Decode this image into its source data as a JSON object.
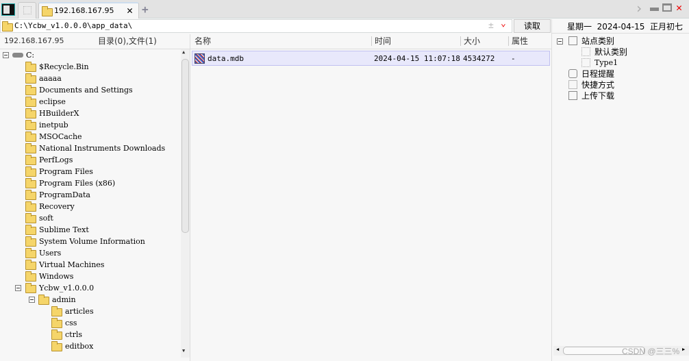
{
  "tabs": {
    "active": "192.168.167.95",
    "close": "✕",
    "add": "+"
  },
  "window": {
    "next": "›",
    "min": "▬",
    "max": "□",
    "close": "✕"
  },
  "address": {
    "path": "C:\\Ycbw_v1.0.0.0\\app_data\\",
    "plusminus": "±",
    "dropdown": "⌄",
    "read_button": "读取"
  },
  "left_panel": {
    "host": "192.168.167.95",
    "summary": "目录(0),文件(1)",
    "tree": [
      {
        "label": "C:",
        "level": 0,
        "expanded": true,
        "drive": true
      },
      {
        "label": "$Recycle.Bin",
        "level": 1
      },
      {
        "label": "aaaaa",
        "level": 1
      },
      {
        "label": "Documents and Settings",
        "level": 1
      },
      {
        "label": "eclipse",
        "level": 1
      },
      {
        "label": "HBuilderX",
        "level": 1
      },
      {
        "label": "inetpub",
        "level": 1
      },
      {
        "label": "MSOCache",
        "level": 1
      },
      {
        "label": "National Instruments Downloads",
        "level": 1
      },
      {
        "label": "PerfLogs",
        "level": 1
      },
      {
        "label": "Program Files",
        "level": 1
      },
      {
        "label": "Program Files (x86)",
        "level": 1
      },
      {
        "label": "ProgramData",
        "level": 1
      },
      {
        "label": "Recovery",
        "level": 1
      },
      {
        "label": "soft",
        "level": 1
      },
      {
        "label": "Sublime Text",
        "level": 1
      },
      {
        "label": "System Volume Information",
        "level": 1
      },
      {
        "label": "Users",
        "level": 1
      },
      {
        "label": "Virtual Machines",
        "level": 1
      },
      {
        "label": "Windows",
        "level": 1
      },
      {
        "label": "Ycbw_v1.0.0.0",
        "level": 1,
        "expanded": true
      },
      {
        "label": "admin",
        "level": 2,
        "expanded": true
      },
      {
        "label": "articles",
        "level": 3
      },
      {
        "label": "css",
        "level": 3
      },
      {
        "label": "ctrls",
        "level": 3
      },
      {
        "label": "editbox",
        "level": 3
      }
    ]
  },
  "file_list": {
    "columns": [
      "名称",
      "时间",
      "大小",
      "属性"
    ],
    "rows": [
      {
        "name": "data.mdb",
        "time": "2024-04-15 11:07:18",
        "size": "4534272",
        "attr": "-"
      }
    ]
  },
  "right_panel": {
    "date": "星期一  2024-04-15  正月初七",
    "tree": [
      {
        "label": "站点类别",
        "level": 0
      },
      {
        "label": "默认类别",
        "level": 1
      },
      {
        "label": "Type1",
        "level": 1
      },
      {
        "label": "日程提醒",
        "level": 0
      },
      {
        "label": "快捷方式",
        "level": 0
      },
      {
        "label": "上传下载",
        "level": 0
      }
    ]
  },
  "watermark": "CSDN @三三%"
}
